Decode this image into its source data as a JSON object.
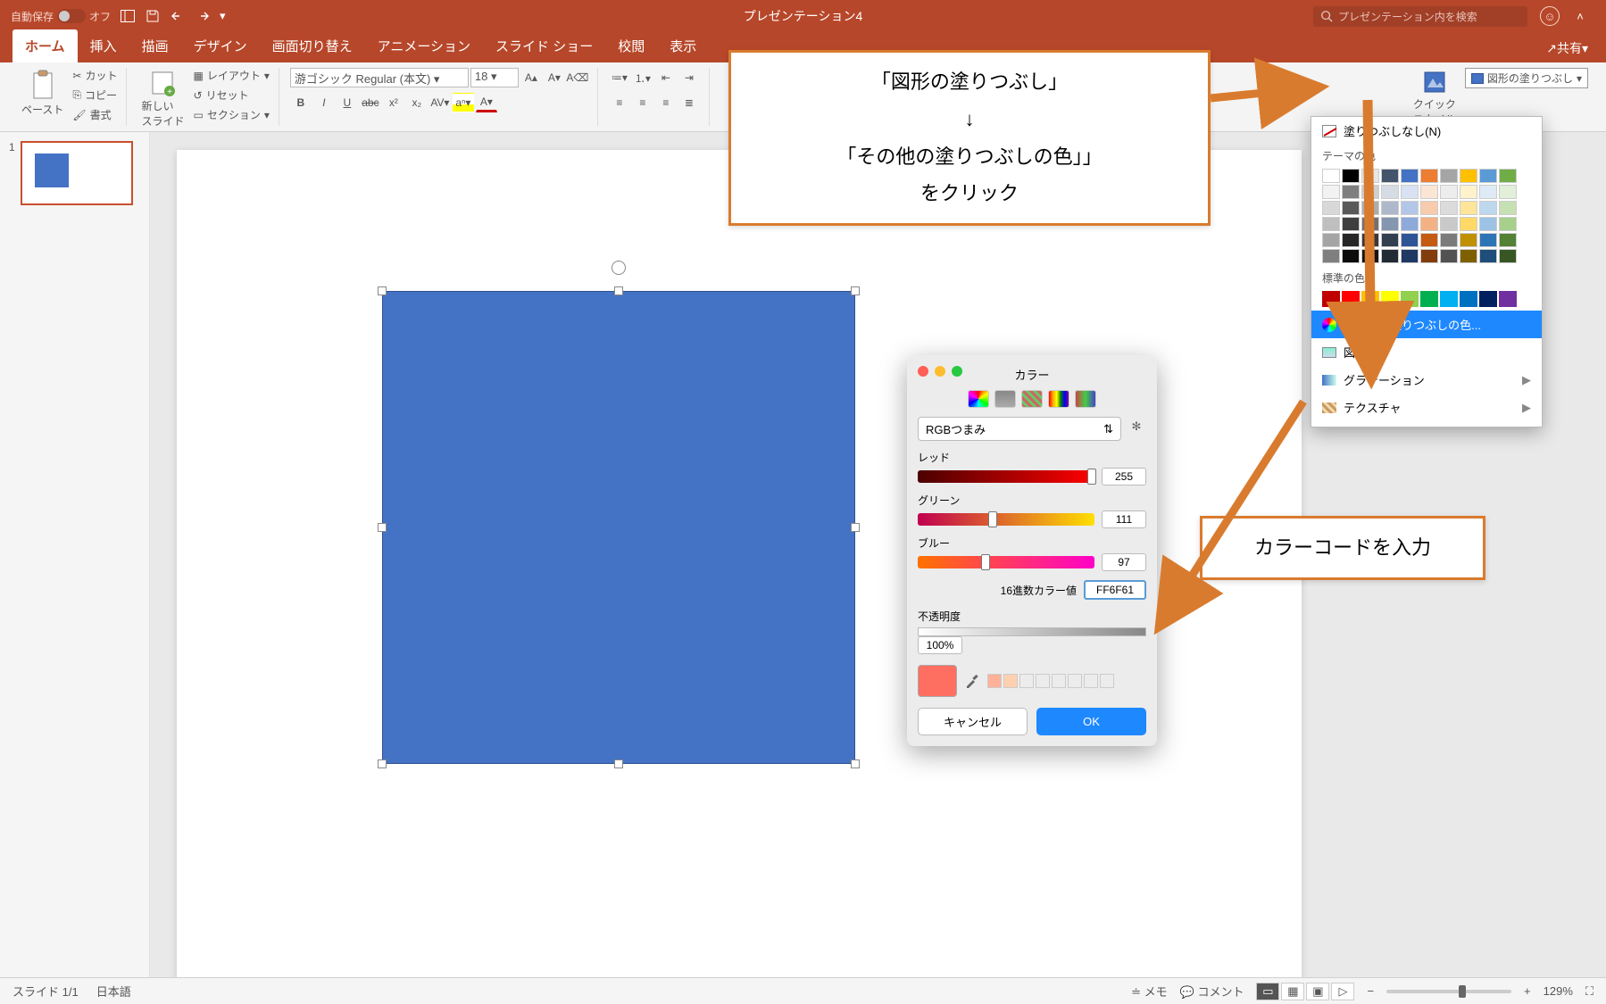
{
  "titlebar": {
    "autosave_label": "自動保存",
    "autosave_state": "オフ",
    "title": "プレゼンテーション4",
    "search_placeholder": "プレゼンテーション内を検索"
  },
  "tabs": {
    "home": "ホーム",
    "insert": "挿入",
    "draw": "描画",
    "design": "デザイン",
    "transitions": "画面切り替え",
    "animations": "アニメーション",
    "slideshow": "スライド ショー",
    "review": "校閲",
    "view": "表示",
    "share": "共有"
  },
  "ribbon": {
    "paste": "ペースト",
    "cut": "カット",
    "copy": "コピー",
    "format": "書式",
    "new_slide": "新しい\nスライド",
    "layout": "レイアウト",
    "reset": "リセット",
    "section": "セクション",
    "font_name": "游ゴシック Regular (本文)",
    "font_size": "18",
    "quick_style": "クイック\nスタイル",
    "shape_fill": "図形の塗りつぶし"
  },
  "fill_dropdown": {
    "no_fill": "塗りつぶしなし(N)",
    "theme_colors": "テーマの色",
    "standard_colors": "標準の色",
    "more_colors": "その他の塗りつぶしの色...",
    "picture": "図...",
    "gradient": "グラデーション",
    "texture": "テクスチャ",
    "theme_grid": [
      "#ffffff",
      "#000000",
      "#e7e6e6",
      "#44546a",
      "#4472c4",
      "#ed7d31",
      "#a5a5a5",
      "#ffc000",
      "#5b9bd5",
      "#70ad47",
      "#f2f2f2",
      "#7f7f7f",
      "#d0cece",
      "#d6dce4",
      "#d9e2f3",
      "#fbe5d5",
      "#ededed",
      "#fff2cc",
      "#deebf6",
      "#e2efd9",
      "#d8d8d8",
      "#595959",
      "#aeabab",
      "#adb9ca",
      "#b4c6e7",
      "#f7cbac",
      "#dbdbdb",
      "#fee599",
      "#bdd7ee",
      "#c5e0b3",
      "#bfbfbf",
      "#3f3f3f",
      "#757070",
      "#8496b0",
      "#8eaadb",
      "#f4b183",
      "#c9c9c9",
      "#ffd965",
      "#9cc3e5",
      "#a8d08d",
      "#a5a5a5",
      "#262626",
      "#3a3838",
      "#323f4f",
      "#2f5496",
      "#c55a11",
      "#7b7b7b",
      "#bf9000",
      "#2e75b5",
      "#538135",
      "#7f7f7f",
      "#0c0c0c",
      "#171616",
      "#222a35",
      "#1f3864",
      "#833c0b",
      "#525252",
      "#7f6000",
      "#1e4e79",
      "#375623"
    ],
    "standard_row": [
      "#c00000",
      "#ff0000",
      "#ffc000",
      "#ffff00",
      "#92d050",
      "#00b050",
      "#00b0f0",
      "#0070c0",
      "#002060",
      "#7030a0"
    ]
  },
  "color_picker": {
    "title": "カラー",
    "mode": "RGBつまみ",
    "red_label": "レッド",
    "green_label": "グリーン",
    "blue_label": "ブルー",
    "red_value": "255",
    "green_value": "111",
    "blue_value": "97",
    "hex_label": "16進数カラー値",
    "hex_value": "FF6F61",
    "opacity_label": "不透明度",
    "opacity_value": "100%",
    "cancel": "キャンセル",
    "ok": "OK"
  },
  "annotations": {
    "box1_line1": "「図形の塗りつぶし」",
    "box1_line2": "↓",
    "box1_line3": "「その他の塗りつぶしの色」」",
    "box1_line4": "をクリック",
    "box2": "カラーコードを入力"
  },
  "statusbar": {
    "slide_info": "スライド 1/1",
    "language": "日本語",
    "notes": "メモ",
    "comments": "コメント",
    "zoom": "129%"
  }
}
